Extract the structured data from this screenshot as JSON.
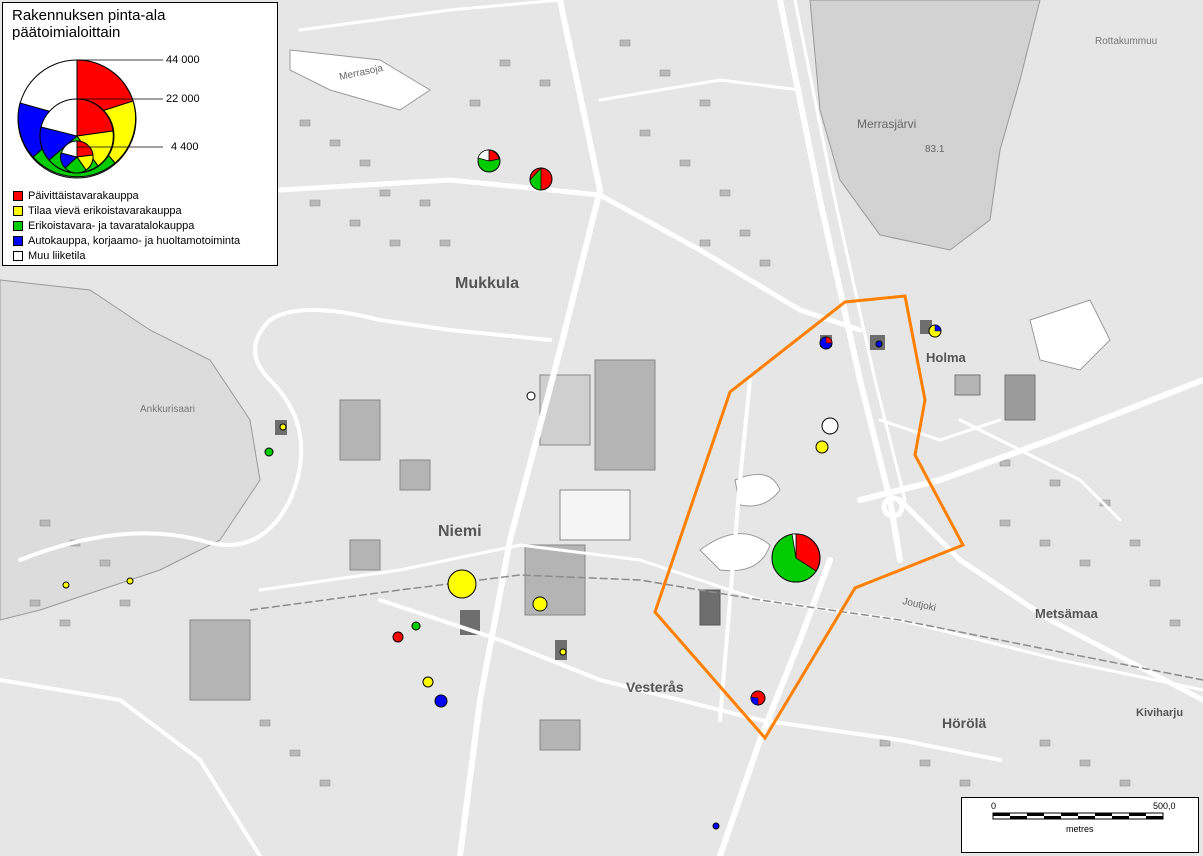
{
  "legend": {
    "title_line1": "Rakennuksen pinta-ala",
    "title_line2": "päätoimialoittain",
    "scale_values": [
      "44 000",
      "22 000",
      "4 400"
    ],
    "items": [
      {
        "label": "Päivittäistavarakauppa",
        "color": "#ff0000"
      },
      {
        "label": "Tilaa vievä erikoistavarakauppa",
        "color": "#ffff00"
      },
      {
        "label": "Erikoistavara- ja tavaratalokauppa",
        "color": "#00cc00"
      },
      {
        "label": "Autokauppa, korjaamo- ja huoltamotoiminta",
        "color": "#0000ff"
      },
      {
        "label": "Muu liiketila",
        "color": "#ffffff"
      }
    ]
  },
  "places": {
    "mukkula": "Mukkula",
    "niemi": "Niemi",
    "holma": "Holma",
    "metsamaa": "Metsämaa",
    "vesteras": "Vesterås",
    "horola": "Hörölä",
    "kiviharju": "Kiviharju",
    "merrasjarvi": "Merrasjärvi",
    "merrasjarvi_elev": "83.1",
    "merrasoja": "Merrasoja",
    "joutjoki": "Joutjoki",
    "ankkurisaari": "Ankkurisaari",
    "rottakummuu": "Rottakummuu"
  },
  "scalebar": {
    "start": "0",
    "end": "500,0",
    "unit": "metres"
  },
  "colors": {
    "boundary": "#ff8000",
    "road": "#ffffff",
    "building": "#b4b4b4",
    "building_dark": "#6e6e6e",
    "water": "#ffffff",
    "background": "#e6e6e6"
  }
}
